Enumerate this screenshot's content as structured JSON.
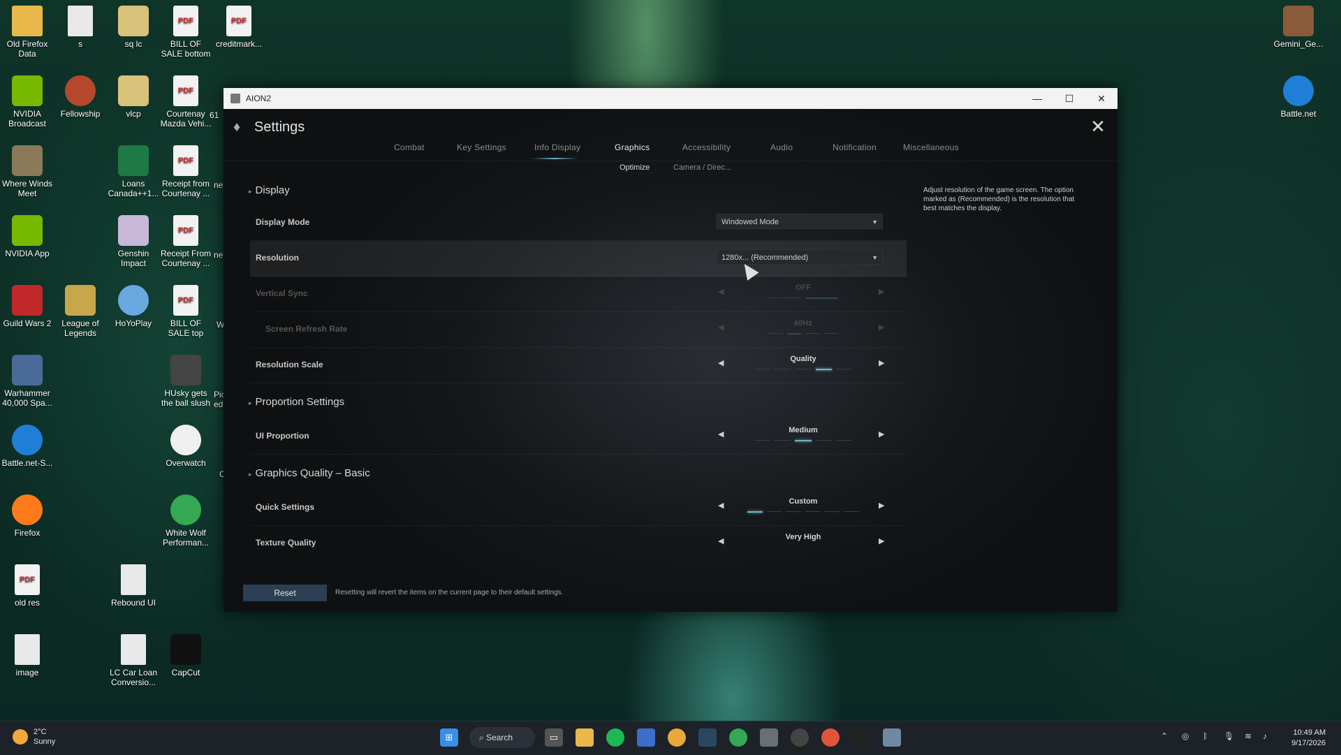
{
  "desktop": {
    "icons_left": [
      {
        "label": "Old Firefox Data",
        "icon": "folder-icon",
        "color": "#e8b84a"
      },
      {
        "label": "s",
        "icon": "file-icon",
        "color": "#e9e9e9"
      },
      {
        "label": "sq lc",
        "icon": "archive-icon",
        "color": "#d8c27a"
      },
      {
        "label": "BILL OF SALE bottom",
        "icon": "pdf-icon",
        "color": "#d32f2f"
      },
      {
        "label": "creditmark...",
        "icon": "pdf-icon",
        "color": "#d32f2f"
      },
      {
        "label": "NVIDIA Broadcast",
        "icon": "nvidia-broadcast-icon",
        "color": "#76b900"
      },
      {
        "label": "Fellowship",
        "icon": "fellowship-icon",
        "color": "#b5482c"
      },
      {
        "label": "vlcp",
        "icon": "archive-icon",
        "color": "#d8c27a"
      },
      {
        "label": "Courtenay Mazda Vehi...",
        "icon": "pdf-icon",
        "color": "#d32f2f"
      },
      {
        "label": "Where Winds Meet",
        "icon": "where-winds-meet-icon",
        "color": "#8a7a5a"
      },
      {
        "label": "Loans Canada++1...",
        "icon": "excel-icon",
        "color": "#1e7a44"
      },
      {
        "label": "Receipt from Courtenay ...",
        "icon": "pdf-icon",
        "color": "#d32f2f"
      },
      {
        "label": "NVIDIA App",
        "icon": "nvidia-app-icon",
        "color": "#76b900"
      },
      {
        "label": "Genshin Impact",
        "icon": "genshin-icon",
        "color": "#c8b8d8"
      },
      {
        "label": "Receipt From Courtenay ...",
        "icon": "pdf-icon",
        "color": "#d32f2f"
      },
      {
        "label": "Guild Wars 2",
        "icon": "guild-wars-icon",
        "color": "#c0282a"
      },
      {
        "label": "League of Legends",
        "icon": "league-icon",
        "color": "#c8a64a"
      },
      {
        "label": "HoYoPlay",
        "icon": "hoyoplay-icon",
        "color": "#6aa8e0"
      },
      {
        "label": "BILL OF SALE top",
        "icon": "pdf-icon",
        "color": "#d32f2f"
      },
      {
        "label": "Warhammer 40,000 Spa...",
        "icon": "warhammer-icon",
        "color": "#4a6a9a"
      },
      {
        "label": "HUsky gets the ball slush",
        "icon": "video-icon",
        "color": "#444444"
      },
      {
        "label": "Battle.net-S...",
        "icon": "battlenet-icon",
        "color": "#1f7fd6"
      },
      {
        "label": "Overwatch",
        "icon": "overwatch-icon",
        "color": "#f0f0f0"
      },
      {
        "label": "Firefox",
        "icon": "firefox-icon",
        "color": "#ff7a1a"
      },
      {
        "label": "White Wolf Performan...",
        "icon": "chrome-icon",
        "color": "#34a853"
      },
      {
        "label": "old res",
        "icon": "pdf-icon",
        "color": "#d32f2f"
      },
      {
        "label": "Rebound UI",
        "icon": "file-icon",
        "color": "#e9e9e9"
      },
      {
        "label": "image",
        "icon": "image-file-icon",
        "color": "#e9e9e9"
      },
      {
        "label": "LC Car Loan Conversio...",
        "icon": "file-icon",
        "color": "#e9e9e9"
      },
      {
        "label": "CapCut",
        "icon": "capcut-icon",
        "color": "#111111"
      }
    ],
    "partial_labels": [
      "61",
      "ne",
      "ne",
      "W",
      "Pic ed",
      "C"
    ],
    "icons_right": [
      {
        "label": "Gemini_Ge...",
        "icon": "gemini-image-icon",
        "color": "#8a5a3a"
      },
      {
        "label": "Battle.net",
        "icon": "battlenet-icon",
        "color": "#1f7fd6"
      }
    ]
  },
  "window": {
    "title": "AION2",
    "minimize": "—",
    "maximize": "☐",
    "close": "✕"
  },
  "settings": {
    "title": "Settings",
    "close": "✕",
    "tabs": [
      "Combat",
      "Key Settings",
      "Info Display",
      "Graphics",
      "Accessibility",
      "Audio",
      "Notification",
      "Miscellaneous"
    ],
    "active_tab": "Graphics",
    "subtabs": [
      "Optimize",
      "Camera / Direc..."
    ],
    "active_subtab": "Optimize",
    "sections": {
      "display": "Display",
      "proportion": "Proportion Settings",
      "quality": "Graphics Quality – Basic"
    },
    "rows": {
      "display_mode": {
        "label": "Display Mode",
        "value": "Windowed Mode"
      },
      "resolution": {
        "label": "Resolution",
        "value": "1280x... (Recommended)"
      },
      "vsync": {
        "label": "Vertical Sync",
        "value": "OFF",
        "level_index": 1,
        "levels": 2
      },
      "refresh": {
        "label": "Screen Refresh Rate",
        "value": "60Hz",
        "level_index": 1,
        "levels": 4
      },
      "res_scale": {
        "label": "Resolution Scale",
        "value": "Quality",
        "level_index": 3,
        "levels": 5
      },
      "ui_proportion": {
        "label": "UI Proportion",
        "value": "Medium",
        "level_index": 2,
        "levels": 5
      },
      "quick_settings": {
        "label": "Quick Settings",
        "value": "Custom",
        "level_index": 0,
        "levels": 6
      },
      "texture": {
        "label": "Texture Quality",
        "value": "Very High"
      }
    },
    "help": "Adjust resolution of the game screen. The option marked as (Recommended) is the resolution that best matches the display.",
    "reset_label": "Reset",
    "reset_note": "Resetting will revert the items on the current page to their default settings.",
    "accent_color": "#6fb4c4"
  },
  "taskbar": {
    "weather_temp": "2°C",
    "weather_desc": "Sunny",
    "search_label": "Search",
    "time": "10:49 AM",
    "date": "9/17/2026"
  }
}
